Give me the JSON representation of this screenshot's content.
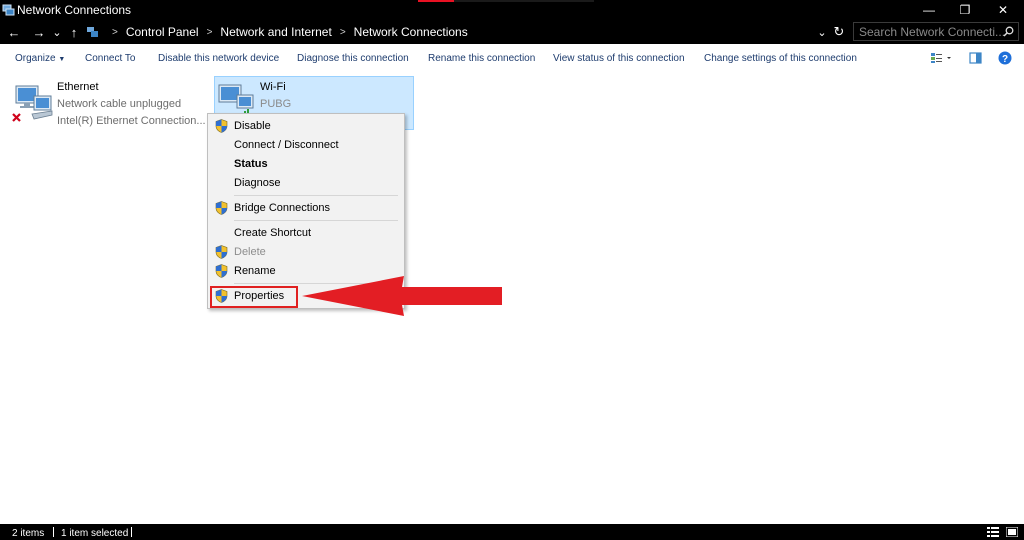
{
  "window": {
    "title": "Network Connections",
    "minimize_glyph": "—",
    "restore_glyph": "❐",
    "close_glyph": "✕"
  },
  "nav": {
    "back_glyph": "←",
    "forward_glyph": "→",
    "recent_glyph": "⌄",
    "up_glyph": "↑",
    "dropdown_glyph": "⌄",
    "refresh_glyph": "↻"
  },
  "breadcrumb": [
    "Control Panel",
    "Network and Internet",
    "Network Connections"
  ],
  "breadcrumb_sep": ">",
  "search": {
    "placeholder": "Search Network Connecti...",
    "icon": "search-icon"
  },
  "toolbar": {
    "organize": "Organize",
    "connect_to": "Connect To",
    "disable": "Disable this network device",
    "diagnose": "Diagnose this connection",
    "rename": "Rename this connection",
    "view_status": "View status of this connection",
    "change_settings": "Change settings of this connection"
  },
  "connections": [
    {
      "name": "Ethernet",
      "status": "Network cable unplugged",
      "device": "Intel(R) Ethernet Connection..."
    },
    {
      "name": "Wi-Fi",
      "status": "PUBG"
    }
  ],
  "context_menu": {
    "items": [
      {
        "label": "Disable",
        "shield": true
      },
      {
        "label": "Connect / Disconnect",
        "shield": false
      },
      {
        "label": "Status",
        "shield": false,
        "bold": true
      },
      {
        "label": "Diagnose",
        "shield": false
      },
      {
        "label": "Bridge Connections",
        "shield": true
      },
      {
        "label": "Create Shortcut",
        "shield": false
      },
      {
        "label": "Delete",
        "shield": true,
        "disabled": true
      },
      {
        "label": "Rename",
        "shield": true
      },
      {
        "label": "Properties",
        "shield": true
      }
    ]
  },
  "status_bar": {
    "items_count": "2 items",
    "selected": "1 item selected"
  },
  "colors": {
    "highlight": "#e02020",
    "selection": "#cce8ff",
    "link": "#1e3c6e"
  }
}
